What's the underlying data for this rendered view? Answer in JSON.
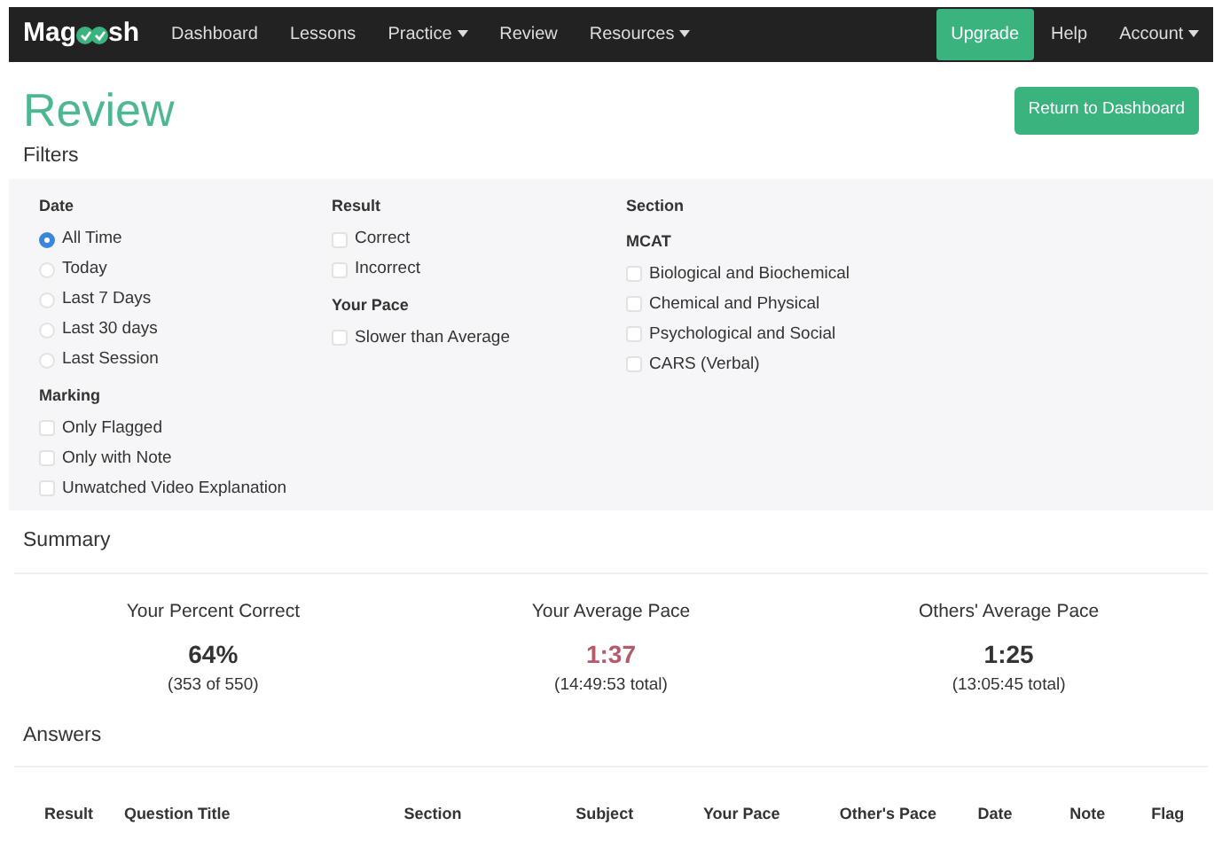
{
  "navbar": {
    "logo": {
      "before": "Mag",
      "after": "sh"
    },
    "links": [
      {
        "label": "Dashboard",
        "dropdown": false
      },
      {
        "label": "Lessons",
        "dropdown": false
      },
      {
        "label": "Practice",
        "dropdown": true
      },
      {
        "label": "Review",
        "dropdown": false
      },
      {
        "label": "Resources",
        "dropdown": true
      }
    ],
    "right": [
      {
        "label": "Upgrade",
        "kind": "button",
        "dropdown": false
      },
      {
        "label": "Help",
        "kind": "link",
        "dropdown": false
      },
      {
        "label": "Account",
        "kind": "link",
        "dropdown": true
      }
    ]
  },
  "title": "Review",
  "return_button": "Return to Dashboard",
  "filters": {
    "title": "Filters",
    "columns": [
      [
        {
          "heading": "Date",
          "options": [
            {
              "label": "All Time",
              "kind": "radio",
              "checked": true
            },
            {
              "label": "Today",
              "kind": "radio",
              "checked": false
            },
            {
              "label": "Last 7 Days",
              "kind": "radio",
              "checked": false
            },
            {
              "label": "Last 30 days",
              "kind": "radio",
              "checked": false
            },
            {
              "label": "Last Session",
              "kind": "radio",
              "checked": false
            }
          ]
        },
        {
          "heading": "Marking",
          "options": [
            {
              "label": "Only Flagged",
              "kind": "checkbox",
              "checked": false
            },
            {
              "label": "Only with Note",
              "kind": "checkbox",
              "checked": false
            },
            {
              "label": "Unwatched Video Explanation",
              "kind": "checkbox",
              "checked": false
            }
          ]
        }
      ],
      [
        {
          "heading": "Result",
          "options": [
            {
              "label": "Correct",
              "kind": "checkbox",
              "checked": false
            },
            {
              "label": "Incorrect",
              "kind": "checkbox",
              "checked": false
            }
          ]
        },
        {
          "heading": "Your Pace",
          "options": [
            {
              "label": "Slower than Average",
              "kind": "checkbox",
              "checked": false
            }
          ]
        }
      ],
      [
        {
          "heading": "Section",
          "subheading": "MCAT",
          "options": [
            {
              "label": "Biological and Biochemical",
              "kind": "checkbox",
              "checked": false
            },
            {
              "label": "Chemical and Physical",
              "kind": "checkbox",
              "checked": false
            },
            {
              "label": "Psychological and Social",
              "kind": "checkbox",
              "checked": false
            },
            {
              "label": "CARS (Verbal)",
              "kind": "checkbox",
              "checked": false
            }
          ]
        }
      ]
    ]
  },
  "summary": {
    "title": "Summary",
    "stats": [
      {
        "label": "Your Percent Correct",
        "value": "64%",
        "detail": "(353 of 550)",
        "color": "#333333"
      },
      {
        "label": "Your Average Pace",
        "value": "1:37",
        "detail": "(14:49:53 total)",
        "color": "#b55a68"
      },
      {
        "label": "Others' Average Pace",
        "value": "1:25",
        "detail": "(13:05:45 total)",
        "color": "#333333"
      }
    ]
  },
  "answers": {
    "title": "Answers",
    "columns": [
      "Result",
      "Question Title",
      "Section",
      "Subject",
      "Your Pace",
      "Other's Pace",
      "Date",
      "Note",
      "Flag"
    ]
  }
}
